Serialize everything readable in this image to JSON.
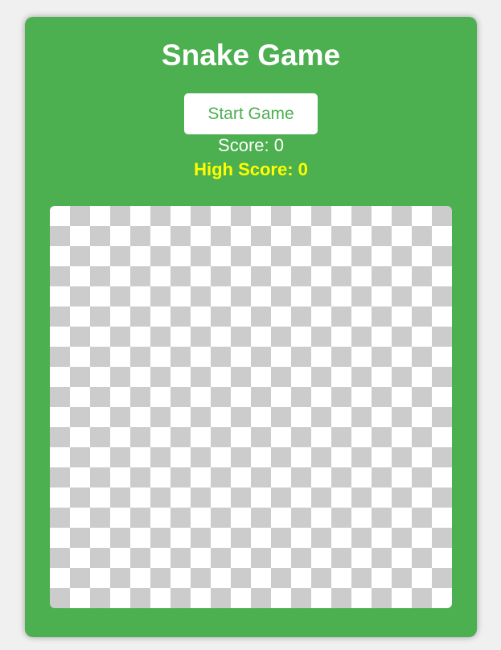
{
  "game": {
    "title": "Snake Game",
    "start_button_label": "Start Game",
    "score_label": "Score: 0",
    "high_score_label": "High Score: 0",
    "score": 0,
    "high_score": 0
  },
  "colors": {
    "panel": "#4caf50",
    "page_background": "#f0f0f0",
    "board_light": "#ffffff",
    "board_dark": "#cccccc",
    "high_score_text": "#ffff00"
  },
  "board": {
    "rows": 20,
    "columns": 20
  }
}
